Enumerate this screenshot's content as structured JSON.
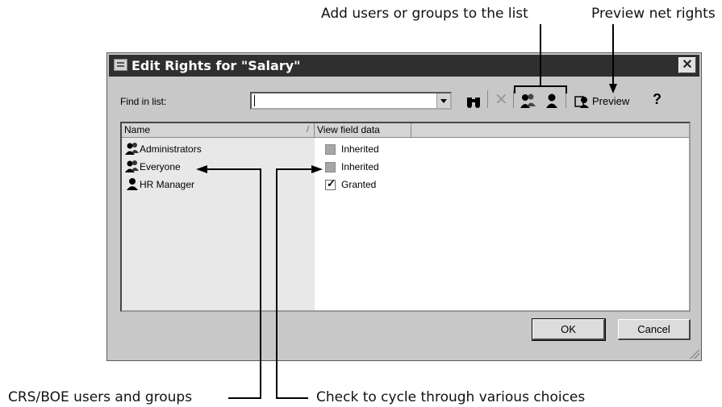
{
  "callouts": {
    "add_users": "Add users or groups to the list",
    "preview_rights": "Preview net rights",
    "crs_users": "CRS/BOE users and groups",
    "check_cycle": "Check to cycle through various choices"
  },
  "dialog": {
    "title": "Edit Rights for \"Salary\"",
    "close_glyph": "✕",
    "find_label": "Find in list:",
    "find_value": "",
    "toolbar": {
      "find_glyph": "🔍",
      "delete_glyph": "✕",
      "preview_label": "Preview",
      "help_glyph": "?"
    },
    "columns": {
      "name": "Name",
      "sort_glyph": "/",
      "view_field_data": "View field data"
    },
    "rows": [
      {
        "name": "Administrators",
        "state": "Inherited",
        "icon": "group-icon",
        "checked": false,
        "inherited": true
      },
      {
        "name": "Everyone",
        "state": "Inherited",
        "icon": "group-icon",
        "checked": false,
        "inherited": true
      },
      {
        "name": "HR Manager",
        "state": "Granted",
        "icon": "user-icon",
        "checked": true,
        "inherited": false
      }
    ],
    "ok_label": "OK",
    "cancel_label": "Cancel"
  }
}
